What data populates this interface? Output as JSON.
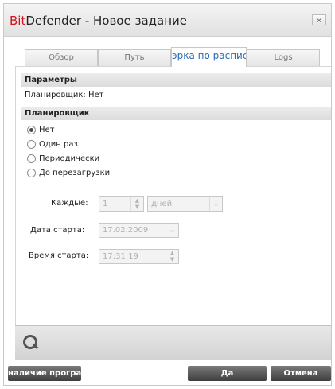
{
  "window": {
    "title_brand": "Bit",
    "title_rest": "Defender - Новое задание",
    "close_label": "×"
  },
  "tabs": [
    {
      "label": "Обзор",
      "active": false
    },
    {
      "label": "Путь",
      "active": false
    },
    {
      "label": "эрка по распис",
      "active": true
    },
    {
      "label": "Logs",
      "active": false
    }
  ],
  "params": {
    "header": "Параметры",
    "scheduler_status": "Планировщик: Нет"
  },
  "scheduler": {
    "header": "Планировщик",
    "options": [
      {
        "label": "Нет",
        "checked": true
      },
      {
        "label": "Один раз",
        "checked": false
      },
      {
        "label": "Периодически",
        "checked": false
      },
      {
        "label": "До перезагрузки",
        "checked": false
      }
    ],
    "every_label": "Каждые:",
    "every_value": "1",
    "every_unit": "дней",
    "start_date_label": "Дата старта:",
    "start_date_value": "17.02.2009",
    "start_time_label": "Время старта:",
    "start_time_value": "17:31:19"
  },
  "footer": {
    "left_button": "наличие програ",
    "ok_button": "Да",
    "cancel_button": "Отмена"
  },
  "icons": {
    "spin_up": "▲",
    "spin_down": "▼",
    "dropdown": "⌵"
  }
}
